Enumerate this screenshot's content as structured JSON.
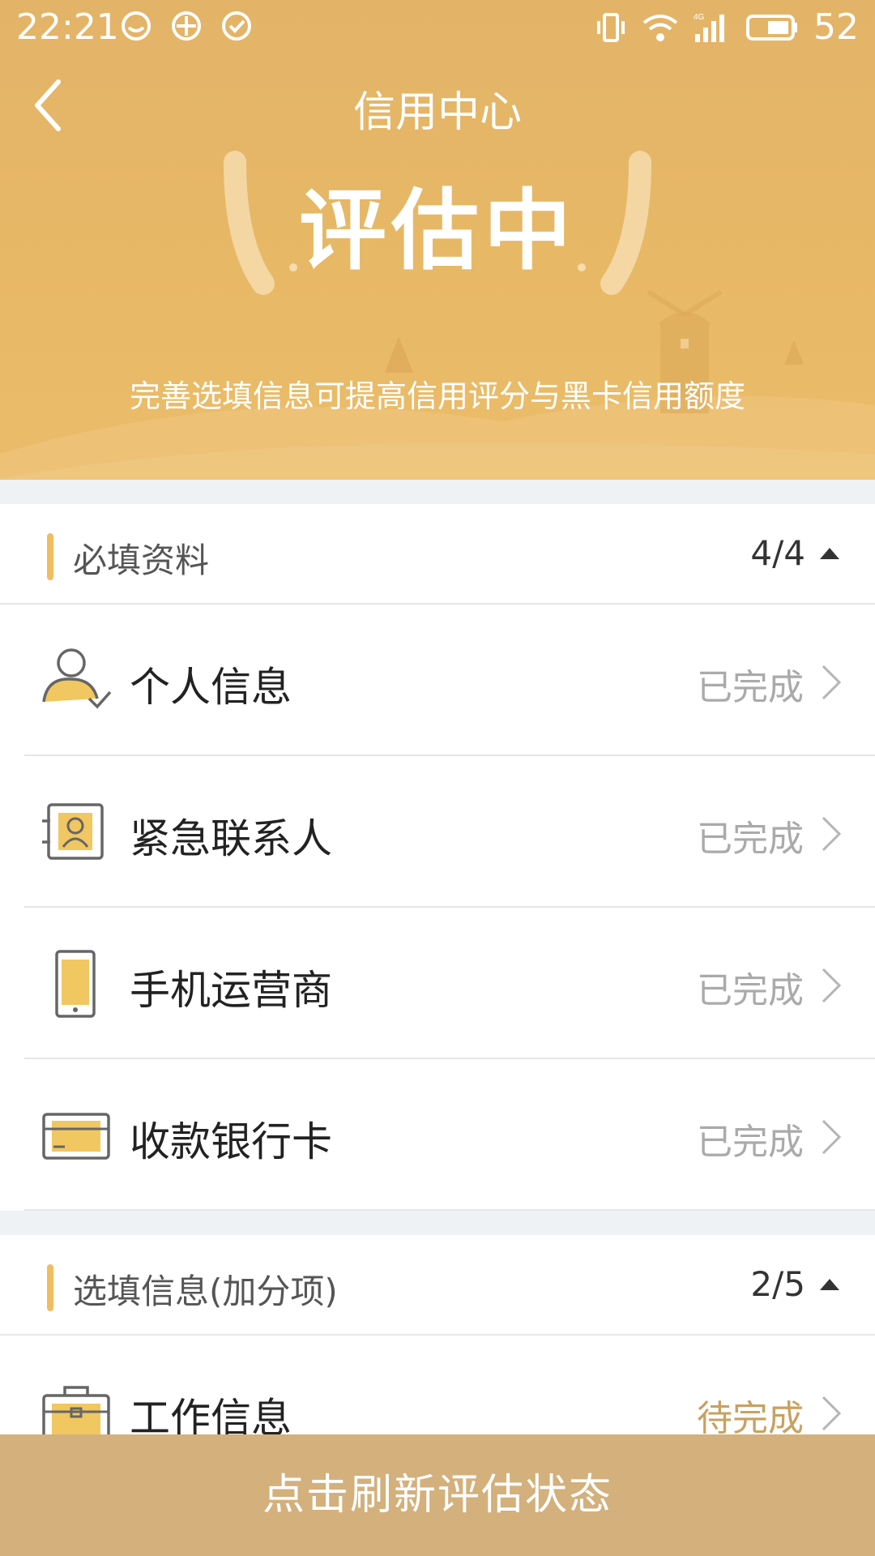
{
  "status_bar": {
    "time": "22:21",
    "battery": "52",
    "network": "4G"
  },
  "nav": {
    "title": "信用中心"
  },
  "hero": {
    "status": "评估中",
    "tip": "完善选填信息可提高信用评分与黑卡信用额度"
  },
  "required": {
    "title": "必填资料",
    "count": "4/4",
    "items": [
      {
        "label": "个人信息",
        "status": "已完成",
        "icon": "person-check-icon"
      },
      {
        "label": "紧急联系人",
        "status": "已完成",
        "icon": "contact-card-icon"
      },
      {
        "label": "手机运营商",
        "status": "已完成",
        "icon": "phone-icon"
      },
      {
        "label": "收款银行卡",
        "status": "已完成",
        "icon": "bank-card-icon"
      }
    ]
  },
  "optional": {
    "title": "选填信息(加分项)",
    "count": "2/5",
    "items": [
      {
        "label": "工作信息",
        "status": "待完成",
        "icon": "briefcase-icon"
      }
    ]
  },
  "footer": {
    "refresh_label": "点击刷新评估状态"
  },
  "colors": {
    "hero_bg": "#e6b767",
    "accent": "#f1bd5e",
    "footer_bg": "#d3b07c",
    "done_text": "#aaaaaa",
    "pending_text": "#c9a160"
  }
}
